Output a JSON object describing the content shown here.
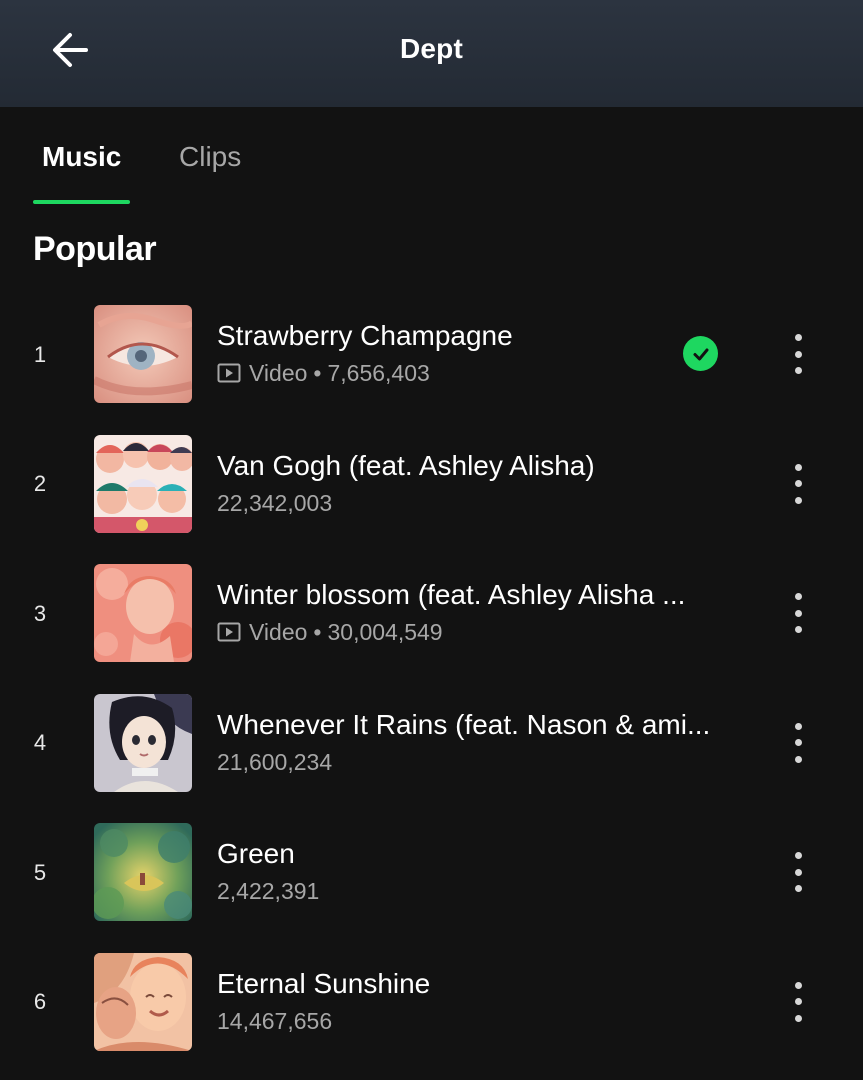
{
  "header": {
    "title": "Dept",
    "back_icon": "arrow-left-icon"
  },
  "tabs": [
    {
      "label": "Music",
      "active": true
    },
    {
      "label": "Clips",
      "active": false
    }
  ],
  "section": {
    "title": "Popular"
  },
  "colors": {
    "accent": "#1ed760",
    "background": "#121212",
    "header": "#2a313c",
    "secondary_text": "#a7a7a7"
  },
  "tracks": [
    {
      "rank": "1",
      "title": "Strawberry Champagne",
      "video": true,
      "video_label": "Video",
      "plays": "7,656,403",
      "downloaded": true
    },
    {
      "rank": "2",
      "title": "Van Gogh (feat. Ashley Alisha)",
      "video": false,
      "video_label": "",
      "plays": "22,342,003",
      "downloaded": false
    },
    {
      "rank": "3",
      "title": "Winter blossom (feat. Ashley Alisha ...",
      "video": true,
      "video_label": "Video",
      "plays": "30,004,549",
      "downloaded": false
    },
    {
      "rank": "4",
      "title": "Whenever It Rains (feat. Nason & ami...",
      "video": false,
      "video_label": "",
      "plays": "21,600,234",
      "downloaded": false
    },
    {
      "rank": "5",
      "title": "Green",
      "video": false,
      "video_label": "",
      "plays": "2,422,391",
      "downloaded": false
    },
    {
      "rank": "6",
      "title": "Eternal Sunshine",
      "video": false,
      "video_label": "",
      "plays": "14,467,656",
      "downloaded": false
    }
  ]
}
